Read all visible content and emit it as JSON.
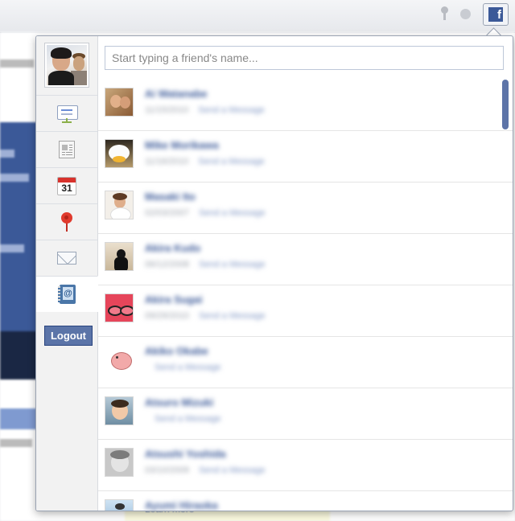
{
  "browser": {
    "extension_icon_letter": "f",
    "extension_icon_name": "facebook-icon"
  },
  "popup": {
    "search": {
      "placeholder": "Start typing a friend's name...",
      "value": ""
    },
    "sidebar": {
      "items": [
        {
          "name": "news-feed",
          "icon": "news-feed-icon"
        },
        {
          "name": "notes",
          "icon": "notes-icon"
        },
        {
          "name": "events",
          "icon": "calendar-icon",
          "text": "31"
        },
        {
          "name": "places",
          "icon": "location-pin-icon"
        },
        {
          "name": "messages",
          "icon": "envelope-icon"
        },
        {
          "name": "contacts",
          "icon": "address-book-icon",
          "active": true
        }
      ],
      "logout_label": "Logout"
    },
    "friends": [
      {
        "name": "Ai Watanabe",
        "timestamp": "11/15/2010",
        "action": "Send a Message"
      },
      {
        "name": "Mike Morikawa",
        "timestamp": "11/16/2010",
        "action": "Send a Message"
      },
      {
        "name": "Masaki Ito",
        "timestamp": "02/03/2007",
        "action": "Send a Message"
      },
      {
        "name": "Akira Kudo",
        "timestamp": "06/12/2008",
        "action": "Send a Message"
      },
      {
        "name": "Akira Sugai",
        "timestamp": "09/29/2010",
        "action": "Send a Message"
      },
      {
        "name": "Akiko Okabe",
        "timestamp": "",
        "action": "Send a Message"
      },
      {
        "name": "Atsuro Mizuki",
        "timestamp": "",
        "action": "Send a Message"
      },
      {
        "name": "Atsushi Yoshida",
        "timestamp": "03/10/2009",
        "action": "Send a Message"
      },
      {
        "name": "Ayumi Hiraoka",
        "timestamp": "",
        "action": ""
      }
    ]
  },
  "background": {
    "learn_more": "Learn more"
  }
}
